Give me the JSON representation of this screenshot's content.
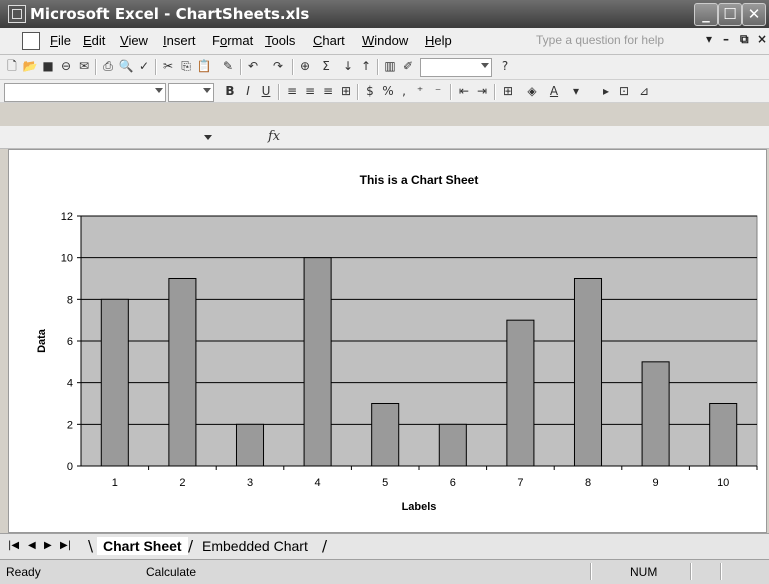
{
  "window": {
    "title": "Microsoft Excel - ChartSheets.xls"
  },
  "menu": [
    {
      "pre": "",
      "acc": "F",
      "post": "ile"
    },
    {
      "pre": "",
      "acc": "E",
      "post": "dit"
    },
    {
      "pre": "",
      "acc": "V",
      "post": "iew"
    },
    {
      "pre": "",
      "acc": "I",
      "post": "nsert"
    },
    {
      "pre": "F",
      "acc": "o",
      "post": "rmat"
    },
    {
      "pre": "",
      "acc": "T",
      "post": "ools"
    },
    {
      "pre": "",
      "acc": "C",
      "post": "hart"
    },
    {
      "pre": "",
      "acc": "W",
      "post": "indow"
    },
    {
      "pre": "",
      "acc": "H",
      "post": "elp"
    }
  ],
  "help_placeholder": "Type a question for help",
  "formula": {
    "fx": "fx"
  },
  "chart_data": {
    "type": "bar",
    "title": "This is a Chart Sheet",
    "xlabel": "Labels",
    "ylabel": "Data",
    "categories": [
      "1",
      "2",
      "3",
      "4",
      "5",
      "6",
      "7",
      "8",
      "9",
      "10"
    ],
    "values": [
      8,
      9,
      2,
      10,
      3,
      2,
      7,
      9,
      5,
      3
    ],
    "ylim": [
      0,
      12
    ],
    "yticks": [
      0,
      2,
      4,
      6,
      8,
      10,
      12
    ],
    "grid": true,
    "legend": "none",
    "colors": {
      "plot_bg": "#c0c0c0",
      "bar": "#9a9a9a",
      "bar_edge": "#000000"
    }
  },
  "tabs": {
    "items": [
      {
        "label": "Chart Sheet",
        "active": true
      },
      {
        "label": "Embedded Chart",
        "active": false
      }
    ]
  },
  "status": {
    "left": "Ready",
    "mode": "Calculate",
    "num": "NUM"
  }
}
